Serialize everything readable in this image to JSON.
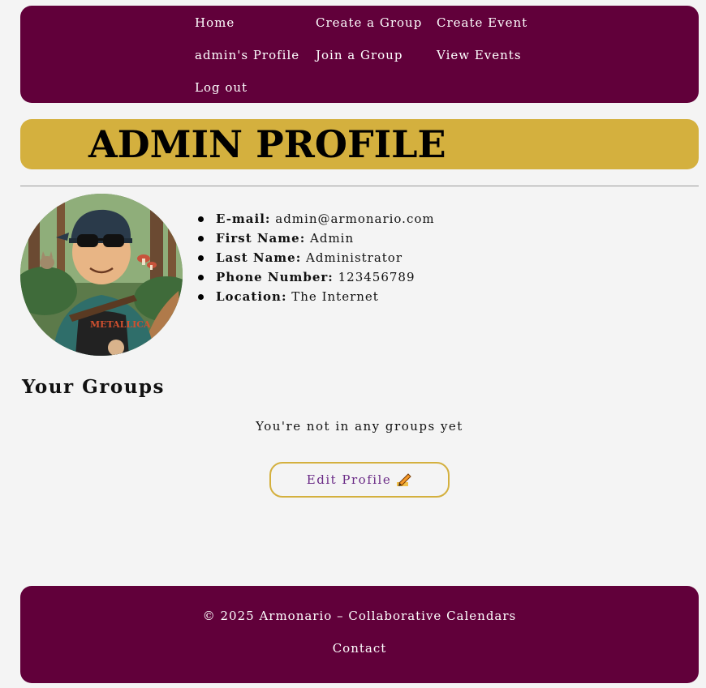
{
  "nav": {
    "home": "Home",
    "create_group": "Create a Group",
    "create_event": "Create Event",
    "profile": "admin's Profile",
    "join_group": "Join a Group",
    "view_events": "View Events",
    "logout": "Log out"
  },
  "page_title": "ADMIN PROFILE",
  "profile": {
    "avatar_icon": "user-avatar-illustration",
    "fields": [
      {
        "label": "E-mail:",
        "value": "admin@armonario.com"
      },
      {
        "label": "First Name:",
        "value": "Admin"
      },
      {
        "label": "Last Name:",
        "value": "Administrator"
      },
      {
        "label": "Phone Number:",
        "value": "123456789"
      },
      {
        "label": "Location:",
        "value": "The Internet"
      }
    ]
  },
  "groups": {
    "heading": "Your Groups",
    "empty_message": "You're not in any groups yet"
  },
  "edit_button": {
    "label": "Edit Profile",
    "icon": "pencil-writing-icon"
  },
  "footer": {
    "copyright": "© 2025 Armonario – Collaborative Calendars",
    "contact": "Contact"
  },
  "colors": {
    "brand": "#61003a",
    "accent": "#d4b03e",
    "button_text": "#6a2a86",
    "background": "#f4f4f4"
  }
}
